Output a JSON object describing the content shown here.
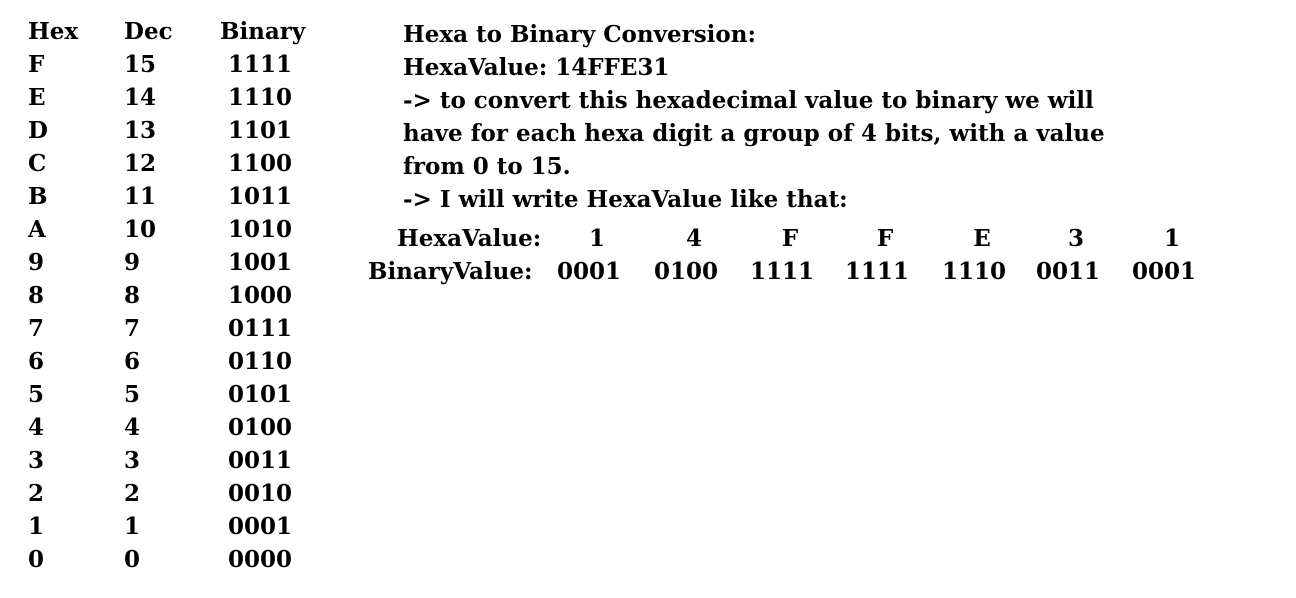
{
  "table": {
    "headers": {
      "hex": "Hex",
      "dec": "Dec",
      "binary": "Binary"
    },
    "rows": [
      {
        "hex": "F",
        "dec": "15",
        "bin": "1111"
      },
      {
        "hex": "E",
        "dec": "14",
        "bin": "1110"
      },
      {
        "hex": "D",
        "dec": "13",
        "bin": "1101"
      },
      {
        "hex": "C",
        "dec": "12",
        "bin": "1100"
      },
      {
        "hex": "B",
        "dec": "11",
        "bin": "1011"
      },
      {
        "hex": "A",
        "dec": "10",
        "bin": "1010"
      },
      {
        "hex": "9",
        "dec": "9",
        "bin": "1001"
      },
      {
        "hex": "8",
        "dec": "8",
        "bin": "1000"
      },
      {
        "hex": "7",
        "dec": "7",
        "bin": "0111"
      },
      {
        "hex": "6",
        "dec": "6",
        "bin": "0110"
      },
      {
        "hex": "5",
        "dec": "5",
        "bin": "0101"
      },
      {
        "hex": "4",
        "dec": "4",
        "bin": "0100"
      },
      {
        "hex": "3",
        "dec": "3",
        "bin": "0011"
      },
      {
        "hex": "2",
        "dec": "2",
        "bin": "0010"
      },
      {
        "hex": "1",
        "dec": "1",
        "bin": "0001"
      },
      {
        "hex": "0",
        "dec": "0",
        "bin": "0000"
      }
    ]
  },
  "explanation": {
    "title": "Hexa to Binary Conversion:",
    "hexa_value_line": "HexaValue: 14FFE31",
    "line1": "-> to convert this hexadecimal value to binary we will",
    "line2": "have for each hexa digit a group of 4 bits, with a value",
    "line3": "from 0 to 15.",
    "line4": "-> I will write HexaValue like that:"
  },
  "conversion": {
    "hexa_label": "HexaValue:",
    "binary_label": "BinaryValue:",
    "hexa_digits": [
      "1",
      "4",
      "F",
      "F",
      "E",
      "3",
      "1"
    ],
    "binary_groups": [
      "0001",
      "0100",
      "1111",
      "1111",
      "1110",
      "0011",
      "0001"
    ]
  }
}
